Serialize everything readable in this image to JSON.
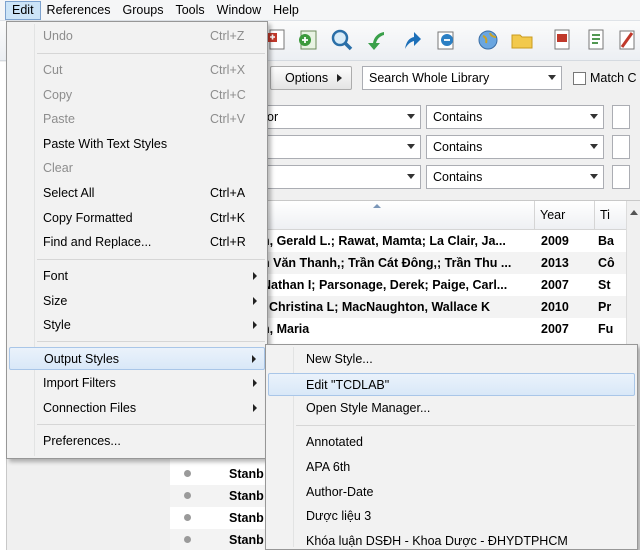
{
  "menubar": {
    "items": [
      "Edit",
      "References",
      "Groups",
      "Tools",
      "Window",
      "Help"
    ]
  },
  "toolbar": {
    "icons": [
      "new-reference-icon",
      "insert-citation-icon",
      "find-icon",
      "back-icon",
      "forward-icon",
      "sync-icon",
      "online-search-icon",
      "folder-icon",
      "pdf-icon",
      "format-icon",
      "output-style-icon"
    ]
  },
  "search": {
    "options_label": "Options",
    "scope_value": "Search Whole Library",
    "match_case_label": "Match C",
    "fields": [
      {
        "field": "or",
        "operator": "Contains"
      },
      {
        "field": "",
        "operator": "Contains"
      },
      {
        "field": "",
        "operator": "Contains"
      }
    ]
  },
  "table": {
    "columns": [
      "Year",
      "Ti"
    ],
    "rows": [
      {
        "author": "n, Gerald L.; Rawat, Mamta; La Clair, Ja...",
        "year": "2009",
        "title": "Ba"
      },
      {
        "author": "n Văn Thanh,; Trần Cát Đông,; Trần Thu ...",
        "year": "2013",
        "title": "Cô"
      },
      {
        "author": "Nathan I; Parsonage, Derek; Paige, Carl...",
        "year": "2007",
        "title": "St"
      },
      {
        "author": ", Christina L; MacNaughton, Wallace K",
        "year": "2010",
        "title": "Pr"
      },
      {
        "author": "n, Maria",
        "year": "2007",
        "title": "Fu"
      },
      {
        "author": "Stanb",
        "year": "",
        "title": ""
      },
      {
        "author": "Stanb",
        "year": "",
        "title": ""
      },
      {
        "author": "Stanb",
        "year": "",
        "title": ""
      },
      {
        "author": "Stanb",
        "year": "",
        "title": ""
      }
    ]
  },
  "edit_menu": {
    "items": [
      {
        "label": "Undo",
        "shortcut": "Ctrl+Z",
        "disabled": true
      },
      {
        "label": "Cut",
        "shortcut": "Ctrl+X",
        "disabled": true
      },
      {
        "label": "Copy",
        "shortcut": "Ctrl+C",
        "disabled": true
      },
      {
        "label": "Paste",
        "shortcut": "Ctrl+V",
        "disabled": true
      },
      {
        "label": "Paste With Text Styles",
        "shortcut": "",
        "disabled": false
      },
      {
        "label": "Clear",
        "shortcut": "",
        "disabled": true
      },
      {
        "label": "Select All",
        "shortcut": "Ctrl+A",
        "disabled": false
      },
      {
        "label": "Copy Formatted",
        "shortcut": "Ctrl+K",
        "disabled": false
      },
      {
        "label": "Find and Replace...",
        "shortcut": "Ctrl+R",
        "disabled": false
      },
      {
        "label": "Font",
        "shortcut": "",
        "disabled": false
      },
      {
        "label": "Size",
        "shortcut": "",
        "disabled": false
      },
      {
        "label": "Style",
        "shortcut": "",
        "disabled": false
      },
      {
        "label": "Output Styles",
        "shortcut": "",
        "disabled": false
      },
      {
        "label": "Import Filters",
        "shortcut": "",
        "disabled": false
      },
      {
        "label": "Connection Files",
        "shortcut": "",
        "disabled": false
      },
      {
        "label": "Preferences...",
        "shortcut": "",
        "disabled": false
      }
    ]
  },
  "output_styles_menu": {
    "items": [
      {
        "label": "New Style..."
      },
      {
        "label": "Edit \"TCDLAB\""
      },
      {
        "label": "Open Style Manager..."
      },
      {
        "label": "Annotated"
      },
      {
        "label": "APA 6th"
      },
      {
        "label": "Author-Date"
      },
      {
        "label": "Dược liệu 3"
      },
      {
        "label": "Khóa luận DSĐH - Khoa Dược - ĐHYDTPHCM"
      }
    ]
  },
  "colors": {
    "highlight": "#d9e8f8",
    "menu_bg": "#f2f2f2",
    "disabled_text": "#8d8d8d"
  }
}
